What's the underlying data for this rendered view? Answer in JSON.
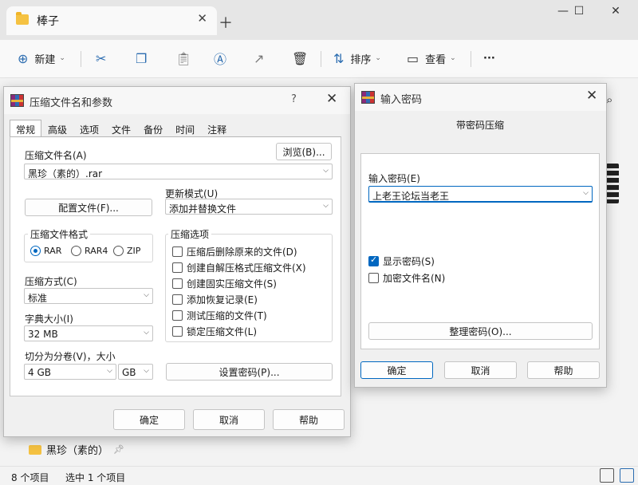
{
  "explorer": {
    "tab_title": "棒子",
    "toolbar": {
      "new_label": "新建",
      "sort_label": "排序",
      "view_label": "查看",
      "more_label": "···"
    },
    "sidebar_item": "黑珍（素的）",
    "status": {
      "count": "8 个项目",
      "selected": "选中 1 个项目"
    }
  },
  "archive_dialog": {
    "title": "压缩文件名和参数",
    "help": "?",
    "tabs": [
      "常规",
      "高级",
      "选项",
      "文件",
      "备份",
      "时间",
      "注释"
    ],
    "archive_name_label": "压缩文件名(A)",
    "browse_label": "浏览(B)...",
    "archive_name_value": "黑珍（素的）.rar",
    "update_mode_label": "更新模式(U)",
    "update_mode_value": "添加并替换文件",
    "profiles_label": "配置文件(F)...",
    "format_group_label": "压缩文件格式",
    "formats": [
      "RAR",
      "RAR4",
      "ZIP"
    ],
    "options_group_label": "压缩选项",
    "options": [
      "压缩后删除原来的文件(D)",
      "创建自解压格式压缩文件(X)",
      "创建固实压缩文件(S)",
      "添加恢复记录(E)",
      "测试压缩的文件(T)",
      "锁定压缩文件(L)"
    ],
    "method_label": "压缩方式(C)",
    "method_value": "标准",
    "dict_label": "字典大小(I)",
    "dict_value": "32 MB",
    "split_label": "切分为分卷(V)，大小",
    "split_value": "4 GB",
    "split_unit": "GB",
    "set_password_label": "设置密码(P)...",
    "ok_label": "确定",
    "cancel_label": "取消",
    "help_label": "帮助"
  },
  "password_dialog": {
    "title": "输入密码",
    "heading": "带密码压缩",
    "password_label": "输入密码(E)",
    "password_value": "上老王论坛当老王",
    "show_password_label": "显示密码(S)",
    "encrypt_names_label": "加密文件名(N)",
    "organize_label": "整理密码(O)...",
    "ok_label": "确定",
    "cancel_label": "取消",
    "help_label": "帮助"
  }
}
